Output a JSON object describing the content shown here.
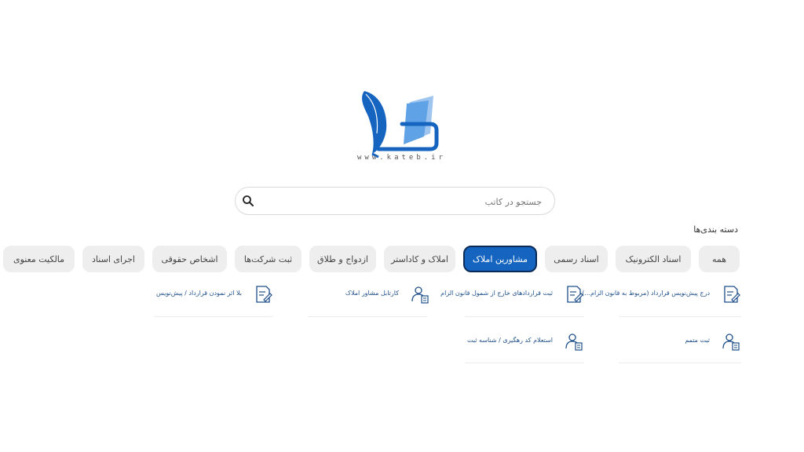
{
  "logo": {
    "url_text": "www.kateb.ir"
  },
  "search": {
    "placeholder": "جستجو در کاتب"
  },
  "categories_title": "دسته بندی‌ها",
  "tabs": [
    {
      "label": "همه"
    },
    {
      "label": "اسناد الکترونیک"
    },
    {
      "label": "اسناد رسمی"
    },
    {
      "label": "مشاورین املاک",
      "active": true
    },
    {
      "label": "املاک و کاداستر"
    },
    {
      "label": "ازدواج و طلاق"
    },
    {
      "label": "ثبت شرکت‌ها"
    },
    {
      "label": "اشخاص حقوقی"
    },
    {
      "label": "اجرای اسناد"
    },
    {
      "label": "مالکیت معنوی"
    }
  ],
  "services": [
    {
      "label": "درج پیش‌نویس قرارداد (مربوط به قانون الزام...)",
      "icon": "document-edit-icon"
    },
    {
      "label": "ثبت قراردادهای خارج از شمول قانون الزام",
      "icon": "document-edit-icon"
    },
    {
      "label": "کارتابل مشاور املاک",
      "icon": "user-document-icon"
    },
    {
      "label": "بلا اثر نمودن قرارداد / پیش‌نویس",
      "icon": "document-edit-icon"
    },
    {
      "label": "ثبت متمم",
      "icon": "user-document-icon"
    },
    {
      "label": "استعلام کد رهگیری / شناسه ثبت",
      "icon": "user-document-icon"
    }
  ],
  "colors": {
    "accent": "#1565c0",
    "tab_bg": "#eeeeee",
    "label": "#1f4f8a"
  }
}
